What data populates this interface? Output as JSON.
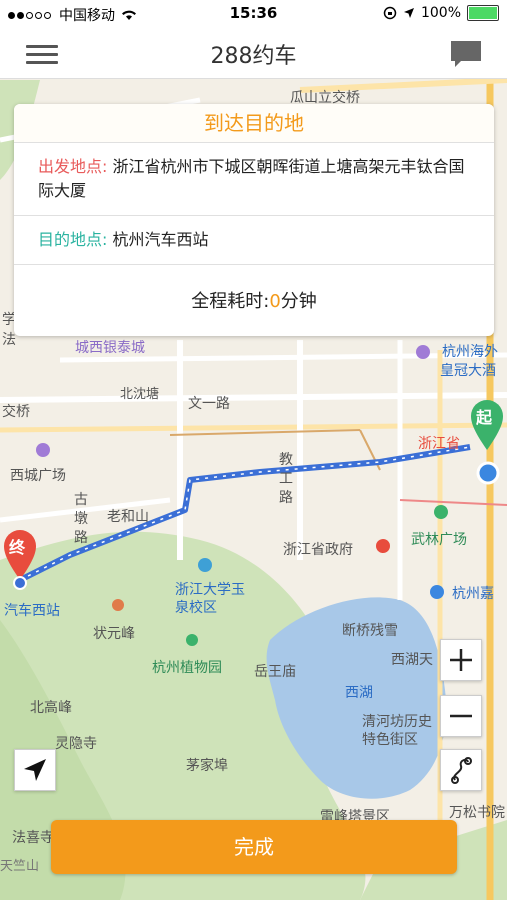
{
  "status": {
    "carrier": "中国移动",
    "time": "15:36",
    "battery": "100%"
  },
  "nav": {
    "title": "288约车"
  },
  "card": {
    "header": "到达目的地",
    "departure_label": "出发地点:",
    "departure_value": "浙江省杭州市下城区朝晖街道上塘高架元丰钛合国际大厦",
    "destination_label": "目的地点:",
    "destination_value": "杭州汽车西站",
    "duration_prefix": "全程耗时:",
    "duration_value": "0",
    "duration_unit": "分钟"
  },
  "map": {
    "start_marker": "起",
    "end_marker": "终",
    "labels": {
      "guashan": "瓜山立交桥",
      "chengxi": "城西银泰城",
      "beishantang": "北沈塘",
      "wenyi": "文一路",
      "jiaoqiao": "交桥",
      "xicheng": "西城广场",
      "gudun": "古墩路",
      "laohe": "老和山",
      "jiaogong": "教工路",
      "zhejiang": "浙江省",
      "zjgov": "浙江省政府",
      "wulin": "武林广场",
      "bus_station": "汽车西站",
      "zju": "浙江大学玉泉校区",
      "zhuangyuan": "状元峰",
      "botanical": "杭州植物园",
      "yuewang": "岳王庙",
      "duanqiao": "断桥残雪",
      "westlake": "西湖",
      "beigao": "北高峰",
      "lingyin": "灵隐寺",
      "maojiabu": "茅家埠",
      "qinghefang": "清河坊历史特色街区",
      "leifeng": "雷峰塔景区",
      "wansong": "万松书院",
      "faxi": "法喜寺",
      "hangzhou_hai": "杭州海外",
      "huangguan": "皇冠大酒",
      "hangzhoujia": "杭州嘉",
      "xihutian": "西湖天",
      "xue": "学",
      "fa": "法",
      "tianzhu": "天竺山"
    }
  },
  "done_label": "完成"
}
